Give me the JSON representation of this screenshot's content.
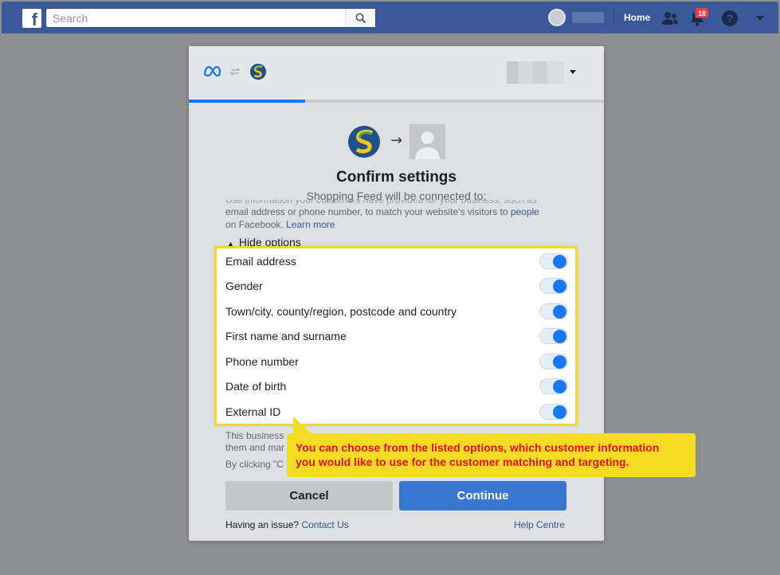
{
  "topbar": {
    "search_placeholder": "Search",
    "home_label": "Home",
    "notification_count": "18"
  },
  "dialog": {
    "progress_fraction": 0.28,
    "title": "Confirm settings",
    "subtitle": "Shopping Feed will be connected to:",
    "desc_cut": "Use information your customers have provided for your business, such as",
    "desc_line": "email address or phone number, to match your website's visitors to",
    "desc_link": "people",
    "desc_line2": "on Facebook.",
    "learn_more": "Learn more",
    "hide_options": "Hide options",
    "below_text_1": "This business",
    "below_text_2": "them and mar",
    "clicking_text": "By clicking \"C",
    "cancel_label": "Cancel",
    "continue_label": "Continue",
    "issue_text": "Having an issue?",
    "contact_us": "Contact Us",
    "help_centre": "Help Centre"
  },
  "options": [
    {
      "label": "Email address",
      "enabled": true
    },
    {
      "label": "Gender",
      "enabled": true
    },
    {
      "label": "Town/city, county/region, postcode and country",
      "enabled": true
    },
    {
      "label": "First name and surname",
      "enabled": true
    },
    {
      "label": "Phone number",
      "enabled": true
    },
    {
      "label": "Date of birth",
      "enabled": true
    },
    {
      "label": "External ID",
      "enabled": true
    }
  ],
  "callout": {
    "line1": "You can choose from the listed options, which customer information",
    "line2": "you would like to use for the customer matching and targeting."
  },
  "colors": {
    "facebook_blue": "#3b5998",
    "toggle_blue": "#1877f2",
    "highlight_yellow": "#f4dc26",
    "callout_text_red": "#e0121a"
  }
}
